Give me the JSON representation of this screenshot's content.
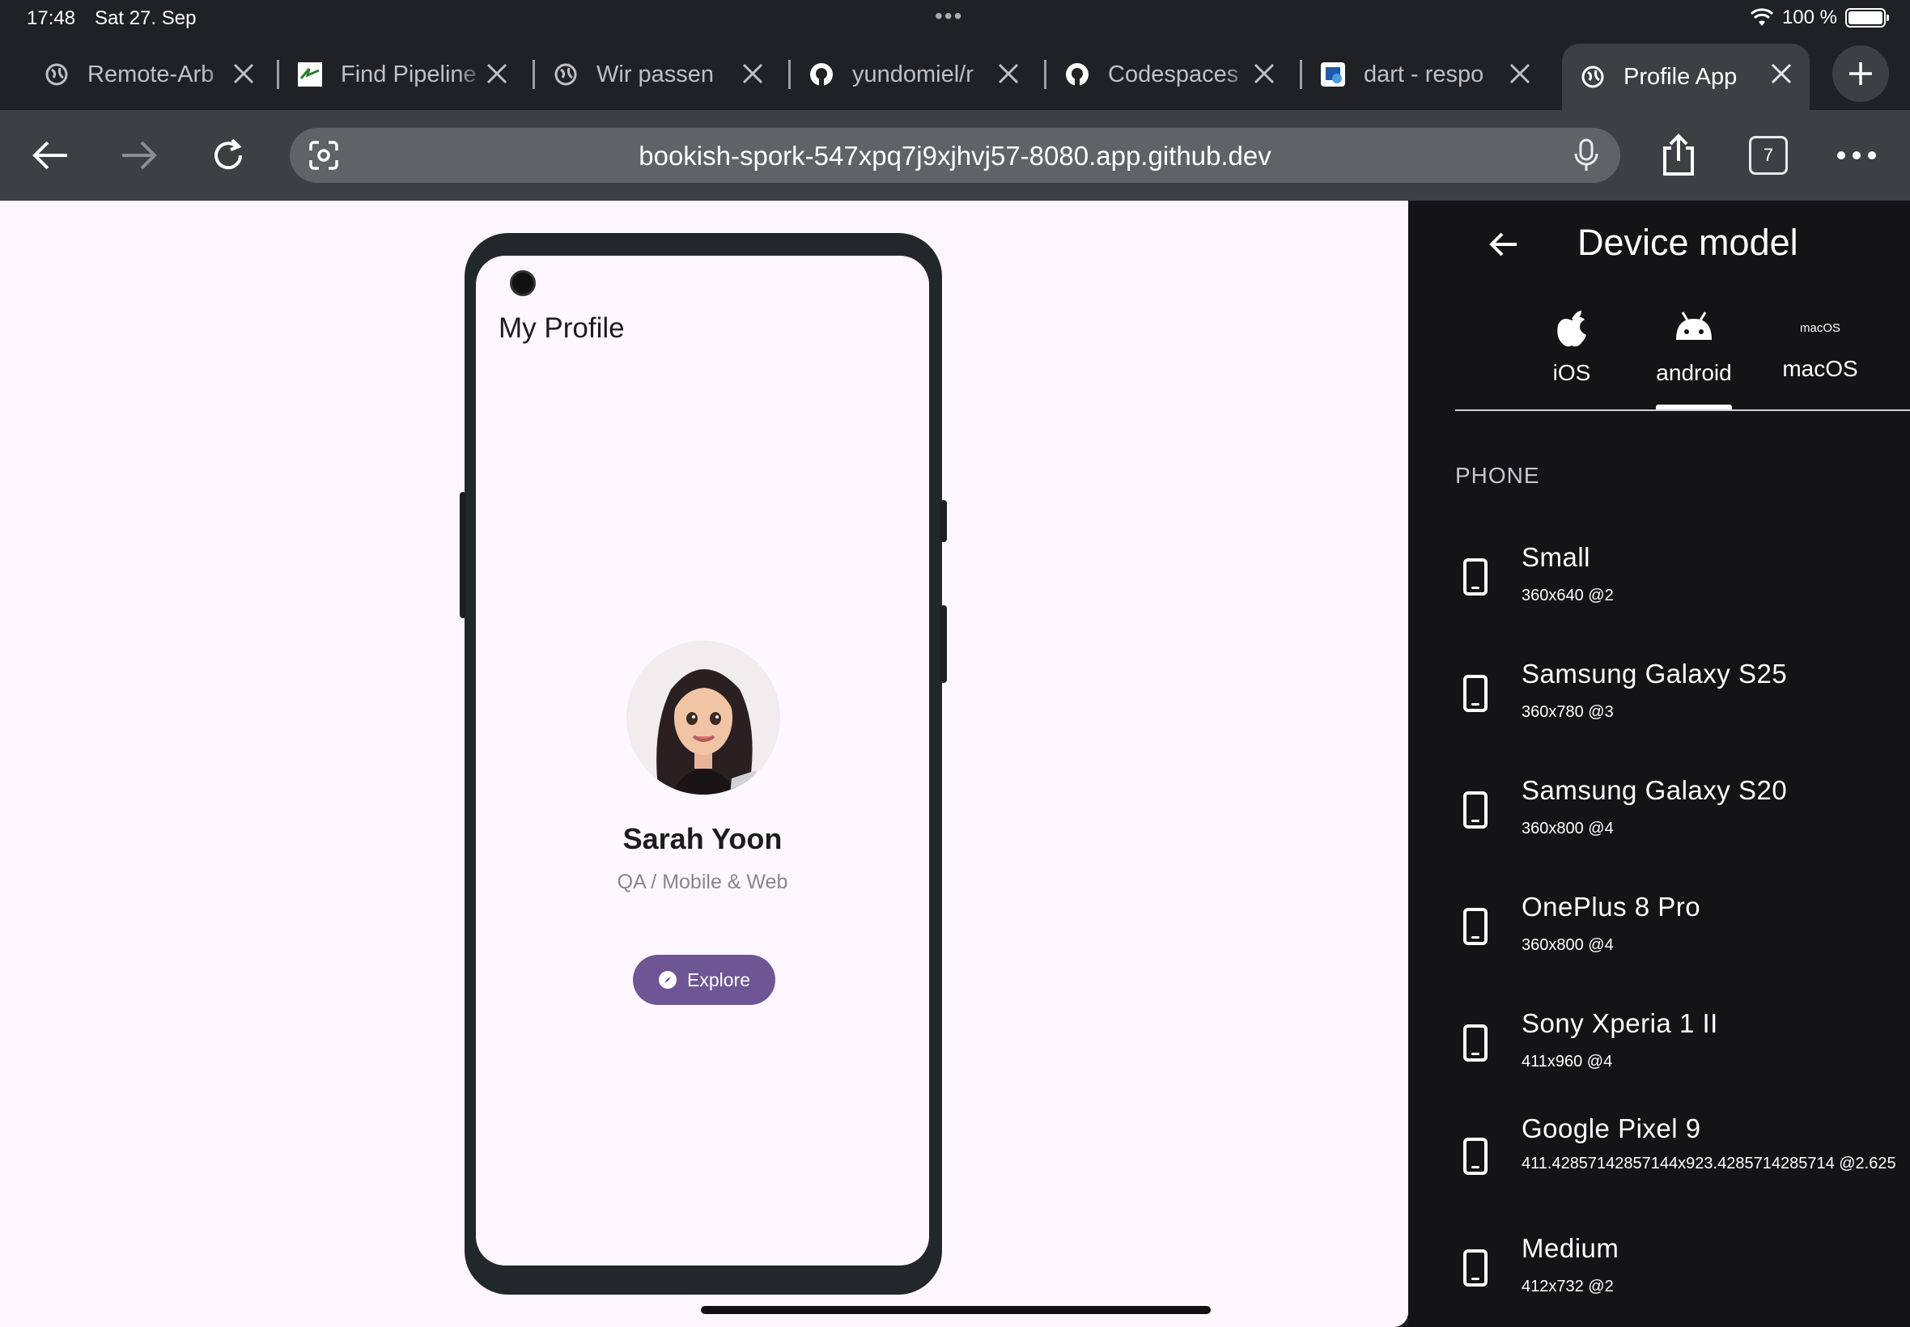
{
  "status": {
    "time": "17:48",
    "date": "Sat 27. Sep",
    "dots": "•••",
    "battery": "100 %"
  },
  "tabs": [
    {
      "label": "Remote-Arb",
      "icon": "globe-icon"
    },
    {
      "label": "Find Pipeline",
      "icon": "site-favicon"
    },
    {
      "label": "Wir passen",
      "icon": "globe-icon"
    },
    {
      "label": "yundomiel/r",
      "icon": "github-icon"
    },
    {
      "label": "Codespaces",
      "icon": "github-icon"
    },
    {
      "label": "dart - respo",
      "icon": "stackexchange-icon"
    },
    {
      "label": "Profile App",
      "icon": "globe-icon",
      "active": true
    }
  ],
  "toolbar": {
    "url": "bookish-spork-547xpq7j9xjhvj57-8080.app.github.dev",
    "tab_count": "7"
  },
  "app": {
    "title": "My Profile",
    "name": "Sarah Yoon",
    "role": "QA / Mobile & Web",
    "explore_label": "Explore"
  },
  "panel": {
    "title": "Device model",
    "platforms": [
      {
        "label": "iOS",
        "icon": "apple-icon"
      },
      {
        "label": "android",
        "icon": "android-icon",
        "selected": true
      },
      {
        "label": "macOS",
        "icon_text": "macOS"
      }
    ],
    "section": "PHONE",
    "devices": [
      {
        "name": "Small",
        "spec": "360x640 @2"
      },
      {
        "name": "Samsung Galaxy S25",
        "spec": "360x780 @3"
      },
      {
        "name": "Samsung Galaxy S20",
        "spec": "360x800 @4"
      },
      {
        "name": "OnePlus 8 Pro",
        "spec": "360x800 @4"
      },
      {
        "name": "Sony Xperia 1 II",
        "spec": "411x960 @4"
      },
      {
        "name": "Google Pixel 9",
        "spec": "411.42857142857144x923.4285714285714 @2.625"
      },
      {
        "name": "Medium",
        "spec": "412x732 @2"
      }
    ]
  }
}
